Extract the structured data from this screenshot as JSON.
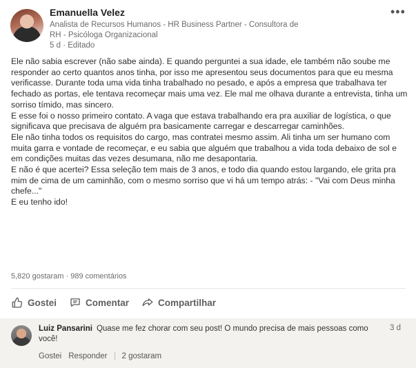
{
  "post": {
    "author": "Emanuella Velez",
    "headline_line1": "Analista de Recursos Humanos - HR Business Partner - Consultora de",
    "headline_line2": "RH - Psicóloga Organizacional",
    "time": "5 d",
    "edited": "Editado",
    "menu_icon": "more-dots-icon",
    "paragraphs": [
      "Ele não sabia escrever (não sabe ainda). E quando perguntei a sua idade, ele também não soube me responder ao certo quantos anos tinha, por isso me apresentou seus documentos para que eu mesma verificasse. Durante toda uma vida tinha trabalhado no pesado, e após a empresa que trabalhava ter fechado as portas, ele tentava recomeçar mais uma vez. Ele mal me olhava durante a entrevista, tinha um sorriso tímido, mas sincero.",
      "E esse foi o nosso primeiro contato. A vaga que estava trabalhando era pra auxiliar de logística, o que significava que precisava de alguém pra basicamente carregar e descarregar caminhões.",
      "Ele não tinha todos os requisitos do cargo, mas contratei mesmo assim. Ali tinha um ser humano com muita garra e vontade de recomeçar, e eu sabia que alguém que trabalhou a vida toda debaixo de sol e em condições muitas das vezes desumana, não me desapontaria.",
      "E não é que acertei? Essa seleção tem mais de 3 anos, e todo dia quando estou largando, ele grita pra mim de cima de um caminhão, com o mesmo sorriso que vi há um tempo atrás: - \"Vai com Deus minha chefe...\"",
      "E eu tenho ido!"
    ],
    "likes": "5,820 gostaram",
    "dot": "·",
    "comments": "989 comentários"
  },
  "actions": {
    "like": "Gostei",
    "comment": "Comentar",
    "share": "Compartilhar"
  },
  "comment": {
    "author": "Luiz Pansarini",
    "text": "Quase me fez chorar com seu post! O mundo precisa de mais pessoas como você!",
    "time": "3 d",
    "like": "Gostei",
    "reply": "Responder",
    "likes": "2 gostaram"
  }
}
